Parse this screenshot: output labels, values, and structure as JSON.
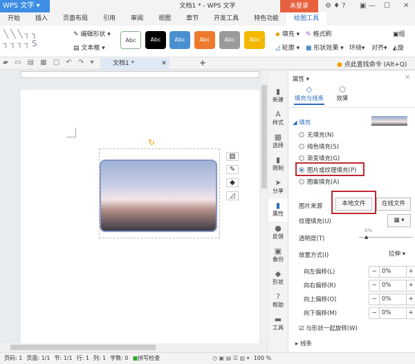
{
  "app": {
    "name": "WPS 文字",
    "title": "文档1 * - WPS 文字",
    "login": "未登录"
  },
  "menu": [
    "开始",
    "插入",
    "页面布局",
    "引用",
    "审阅",
    "视图",
    "章节",
    "开发工具",
    "特色功能",
    "绘图工具"
  ],
  "ribbon": {
    "edit_shape": "编辑形状",
    "text_box": "文本框",
    "styles": [
      {
        "label": "Abc",
        "color": "#ffffff"
      },
      {
        "label": "Abc",
        "color": "#000000"
      },
      {
        "label": "Abc",
        "color": "#4a90d0"
      },
      {
        "label": "Abc",
        "color": "#ee7a2e"
      },
      {
        "label": "Abc",
        "color": "#9a9a9a"
      },
      {
        "label": "Abc",
        "color": "#f5b800"
      }
    ],
    "fill": "填充",
    "format_brush": "格式刷",
    "outline": "轮廓",
    "shape_effect": "形状效果",
    "wrap": "环绕",
    "align": "对齐",
    "group": "组",
    "rotate": "旋"
  },
  "quickbar": {
    "doc_tab": "文档1 *",
    "search": "点此查找命令 (Alt+Q)"
  },
  "side": [
    "新建",
    "样式",
    "选择",
    "限制",
    "分享",
    "属性",
    "反馈",
    "备份",
    "形状",
    "帮助",
    "工具"
  ],
  "panel": {
    "title": "属性",
    "tabs": [
      "填充与线条",
      "效果"
    ],
    "section": "填充",
    "options": [
      "无填充(N)",
      "纯色填充(S)",
      "渐变填充(G)",
      "图片或纹理填充(P)",
      "图案填充(A)"
    ],
    "selected": 3,
    "source_label": "图片来源",
    "local_file": "本地文件",
    "online_file": "在线文件",
    "texture_label": "纹理填充(U)",
    "transparency_label": "透明度(T)",
    "transparency": "0%",
    "placement_label": "放置方式(I)",
    "placement": "拉伸",
    "offsets": [
      {
        "label": "向左偏移(L)",
        "value": "0%"
      },
      {
        "label": "向右偏移(R)",
        "value": "0%"
      },
      {
        "label": "向上偏移(O)",
        "value": "0%"
      },
      {
        "label": "向下偏移(M)",
        "value": "0%"
      }
    ],
    "rotate_with_shape": "与形状一起旋转(W)",
    "line_section": "线条"
  },
  "status": [
    "页码: 1",
    "页面: 1/1",
    "节: 1/1",
    "行: 1",
    "列: 1",
    "字数: 0",
    "拼写检查"
  ],
  "zoom": "100 %"
}
